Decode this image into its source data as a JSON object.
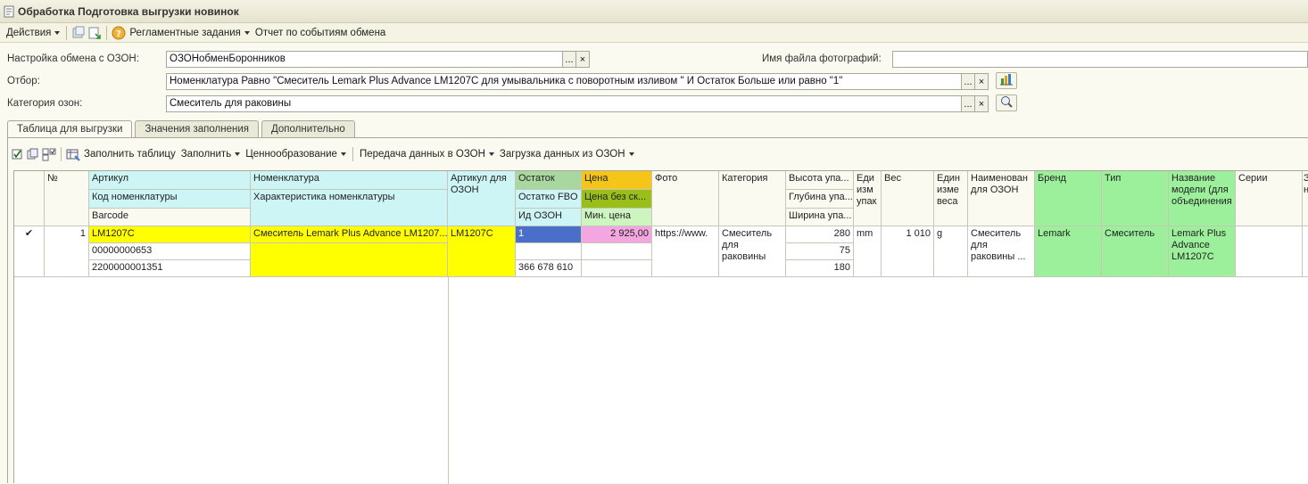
{
  "window": {
    "title": "Обработка  Подготовка выгрузки новинок"
  },
  "menu": {
    "actions": "Действия",
    "scheduled": "Регламентные задания",
    "report": "Отчет по событиям обмена"
  },
  "form": {
    "exchange_label": "Настройка обмена с ОЗОН:",
    "exchange_value": "ОЗОНобменБоронников",
    "photo_label": "Имя файла фотографий:",
    "photo_value": "",
    "filter_label": "Отбор:",
    "filter_value": "Номенклатура Равно \"Смеситель Lemark Plus Advance LM1207C для умывальника с поворотным изливом \" И Остаток Больше или равно \"1\"",
    "category_label": "Категория озон:",
    "category_value": "Смеситель для раковины",
    "ellipsis": "...",
    "clear": "×"
  },
  "tabs": [
    "Таблица для выгрузки",
    "Значения заполнения",
    "Дополнительно"
  ],
  "panel_toolbar": {
    "fill_table": "Заполнить таблицу",
    "fill": "Заполнить",
    "pricing": "Ценнообразование",
    "send": "Передача данных в ОЗОН",
    "load": "Загрузка данных из ОЗОН"
  },
  "table": {
    "headers": {
      "num": "№",
      "article": "Артикул",
      "item_code": "Код номенклатуры",
      "barcode": "Barcode",
      "nomenclature": "Номенклатура",
      "characteristic": "Характеристика номенклатуры",
      "ozon_article": "Артикул для ОЗОН",
      "stock": "Остаток",
      "stock_fbo": "Остатко FBO",
      "ozon_id": "Ид ОЗОН",
      "price": "Цена",
      "price_no_disc": "Цена без ск...",
      "min_price": "Мин. цена",
      "photo": "Фото",
      "category": "Категория",
      "pack_height": "Высота упа...",
      "pack_depth": "Глубина упа...",
      "pack_width": "Ширина упа...",
      "unit": "Еди изм упак",
      "weight": "Вес",
      "weight_unit": "Един изме веса",
      "ozon_name": "Наименован для ОЗОН",
      "brand": "Бренд",
      "type": "Тип",
      "model": "Название модели (для объединения",
      "series": "Серии",
      "extra": "З н"
    },
    "row": {
      "check": "✔",
      "num": "1",
      "article": "LM1207C",
      "item_code": "00000000653",
      "barcode": "2200000001351",
      "nomenclature": "Смеситель Lemark Plus Advance LM1207...",
      "ozon_article": "LM1207C",
      "stock": "1",
      "stock_fbo": "",
      "ozon_id": "366 678 610",
      "price": "2 925,00",
      "price_no_disc": "",
      "min_price": "",
      "photo": "https://www.",
      "category": "Смеситель для раковины",
      "pack_height": "280",
      "pack_depth": "75",
      "pack_width": "180",
      "unit": "mm",
      "weight": "1 010",
      "weight_unit": "g",
      "ozon_name": "Смеситель для раковины ...",
      "brand": "Lemark",
      "type": "Смеситель",
      "model": "Lemark Plus Advance LM1207C"
    }
  },
  "colors": {
    "cyan_header": "#cdf5f5",
    "yellow": "#ffff00",
    "green_header": "#a8d8a0",
    "orange_header": "#f5c518",
    "olive_header": "#9bbf1a",
    "light_green": "#ccf5c0",
    "brand_green": "#9cf09c",
    "pink": "#f4a6e0",
    "selection_blue": "#4a6fc9"
  }
}
